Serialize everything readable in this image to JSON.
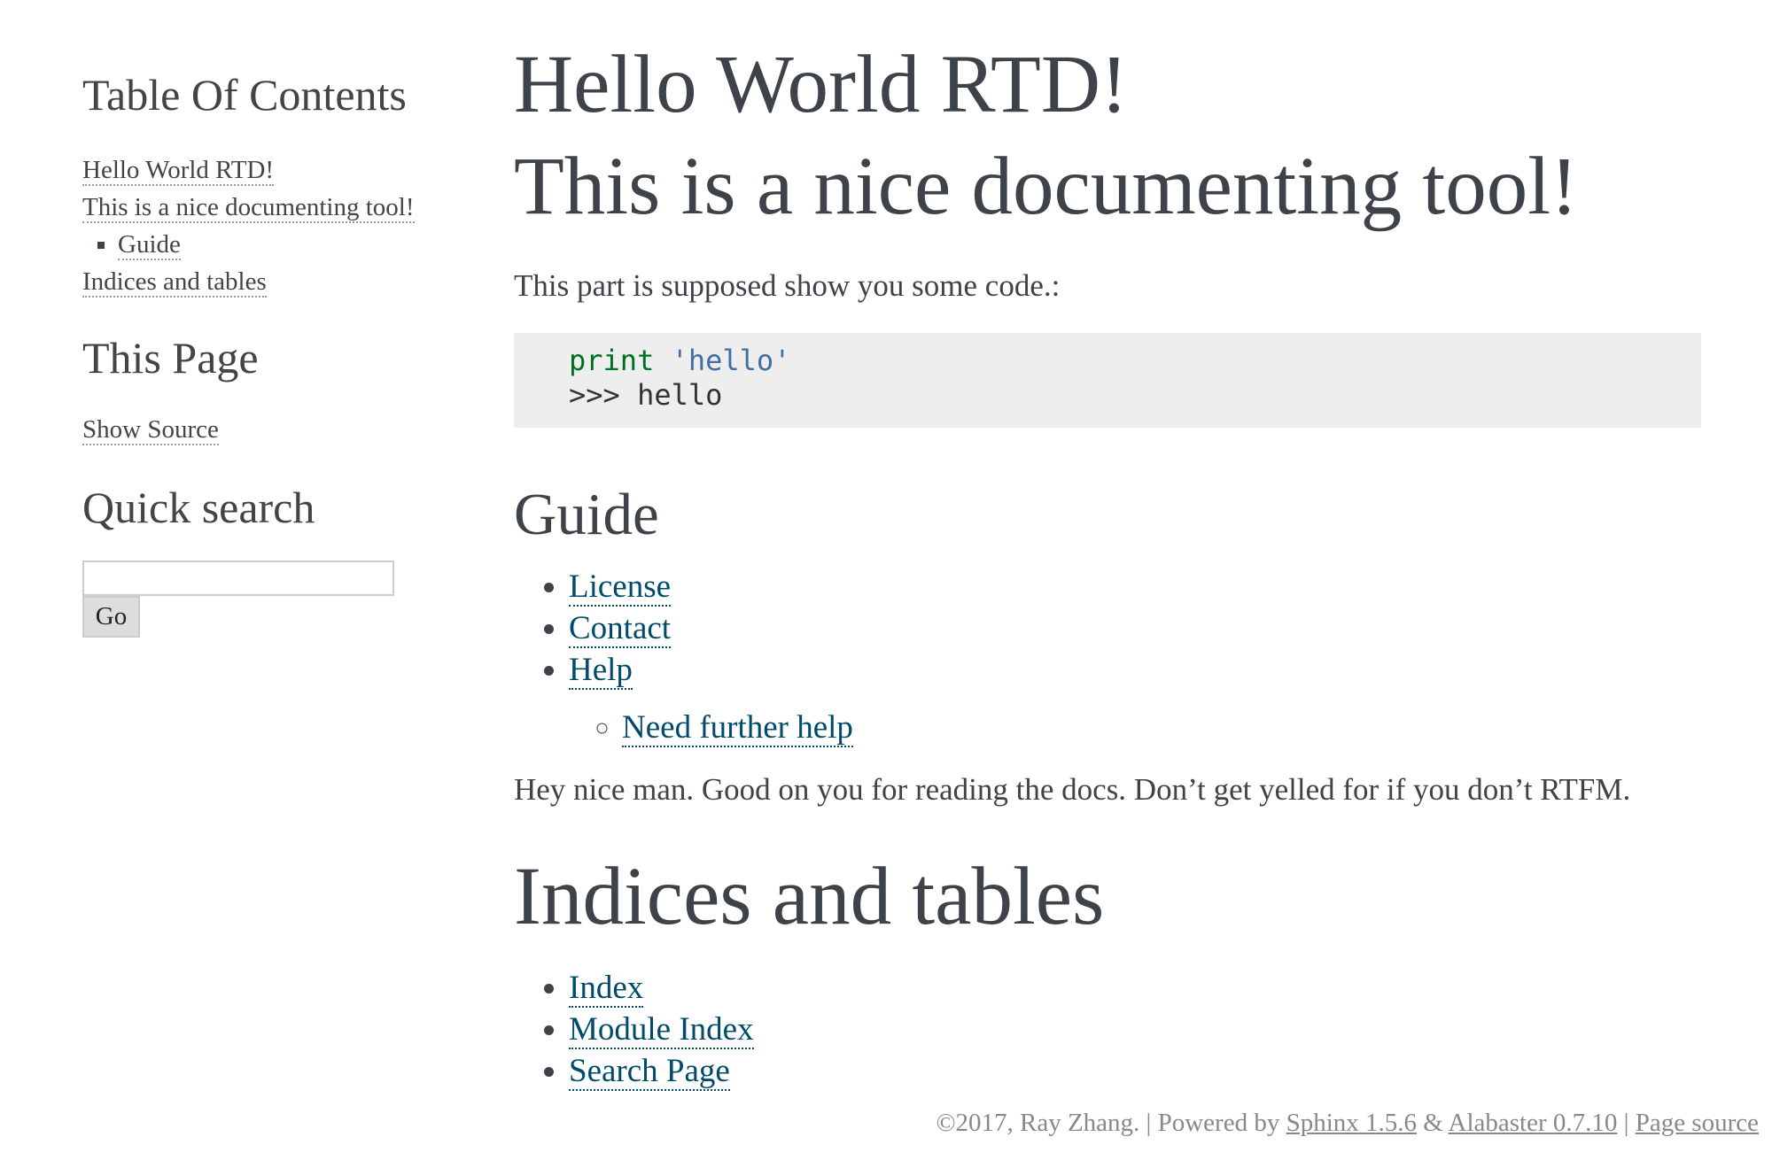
{
  "sidebar": {
    "toc_title": "Table Of Contents",
    "toc": [
      {
        "label": "Hello World RTD!"
      },
      {
        "label": "This is a nice documenting tool!"
      },
      {
        "label": "Guide"
      },
      {
        "label": "Indices and tables"
      }
    ],
    "this_page_title": "This Page",
    "show_source": "Show Source",
    "search_title": "Quick search",
    "search_value": "",
    "go_label": "Go"
  },
  "main": {
    "title": "Hello World RTD!",
    "subtitle": "This is a nice documenting tool!",
    "intro": "This part is supposed show you some code.:",
    "code": {
      "keyword": "print",
      "string": "'hello'",
      "output": ">>> hello"
    },
    "guide": {
      "heading": "Guide",
      "links": [
        {
          "label": "License"
        },
        {
          "label": "Contact"
        },
        {
          "label": "Help"
        }
      ],
      "nested_link": "Need further help",
      "note": "Hey nice man. Good on you for reading the docs. Don’t get yelled for if you don’t RTFM."
    },
    "indices": {
      "heading": "Indices and tables",
      "links": [
        {
          "label": "Index"
        },
        {
          "label": "Module Index"
        },
        {
          "label": "Search Page"
        }
      ]
    }
  },
  "footer": {
    "copyright": "©2017, Ray Zhang.",
    "sep1": "|",
    "powered_by": "Powered by",
    "sphinx_link": "Sphinx 1.5.6",
    "amp": "&",
    "alabaster_link": "Alabaster 0.7.10",
    "sep2": "|",
    "page_source_link": "Page source"
  },
  "colors": {
    "text": "#3e4349",
    "link": "#004b6b",
    "code_bg": "#eeeeee",
    "keyword": "#007020",
    "string": "#4070a0",
    "footer": "#888888"
  }
}
